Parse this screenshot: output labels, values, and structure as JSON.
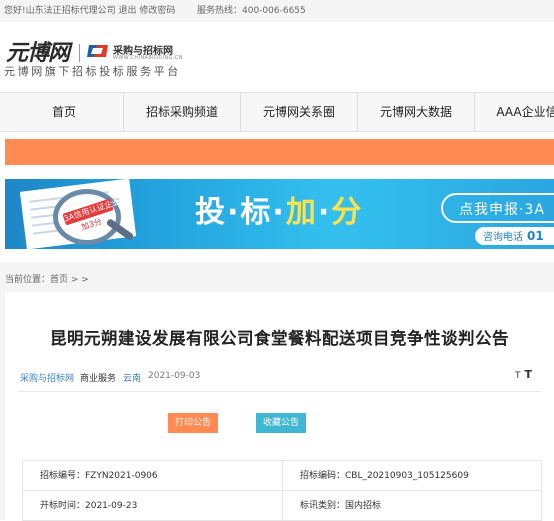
{
  "topbar": {
    "greeting": "您好!山东法正招标代理公司",
    "logout": "退出",
    "change_password": "修改密码",
    "hotline": "服务热线：400-006-6655"
  },
  "header": {
    "logo_text": "元博网",
    "partner_name": "采购与招标网",
    "partner_domain": "WWW.CHINABIDDING.CN",
    "tagline": "元博网旗下招标投标服务平台"
  },
  "nav": {
    "items": [
      {
        "label": "首页"
      },
      {
        "label": "招标采购频道"
      },
      {
        "label": "元博网关系圈"
      },
      {
        "label": "元博网大数据"
      },
      {
        "label": "AAA企业信用"
      }
    ]
  },
  "banner": {
    "badge_line1": "3A信用认证企业",
    "badge_line2": "加3分",
    "title_parts": [
      "投",
      "·",
      "标",
      "·",
      "加",
      "·",
      "分"
    ],
    "cta": "点我申报·3A",
    "phone_label": "咨询电话",
    "phone_prefix": "01"
  },
  "breadcrumb": {
    "text": "当前位置：首页 > >"
  },
  "article": {
    "title": "昆明元朔建设发展有限公司食堂餐料配送项目竞争性谈判公告",
    "source": "采购与招标网",
    "category": "商业服务",
    "region": "云南",
    "date": "2021-09-03",
    "font_small": "T",
    "font_large": "T",
    "print_label": "打印公告",
    "favorite_label": "收藏公告",
    "info": {
      "tender_number": "招标编号：FZYN2021-0906",
      "notice_code": "招标编码：CBL_20210903_105125609",
      "open_time": "开标时间：2021-09-23",
      "info_type": "标讯类别：国内招标"
    }
  },
  "colors": {
    "accent_orange": "#ff8a52",
    "meta_blue": "#3a7fbf",
    "print_btn": "#ff8a52",
    "favorite_btn": "#3fb6d2",
    "banner_blue": "#23a3dd"
  }
}
